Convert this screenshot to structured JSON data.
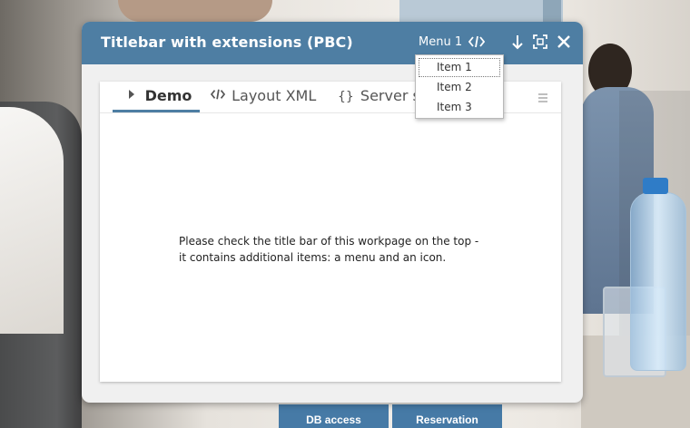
{
  "window": {
    "title": "Titlebar with extensions (PBC)",
    "menu_label": "Menu 1",
    "icons": [
      "code-icon",
      "pin-down-icon",
      "maximize-icon",
      "close-icon"
    ],
    "accent_color": "#4e7ea3"
  },
  "tabs": [
    {
      "label": "Demo",
      "icon": "caret-right-icon",
      "active": true
    },
    {
      "label": "Layout XML",
      "icon": "code-icon",
      "active": false
    },
    {
      "label": "Server side code",
      "icon": "braces-icon",
      "active": false
    }
  ],
  "content": {
    "line1": "Please check the title bar of this workpage on the top -",
    "line2": "it contains additional items: a menu and an icon."
  },
  "dropdown": {
    "items": [
      "Item 1",
      "Item 2",
      "Item 3"
    ],
    "focused_index": 0
  },
  "background_tiles": [
    "DB access",
    "Reservation"
  ]
}
